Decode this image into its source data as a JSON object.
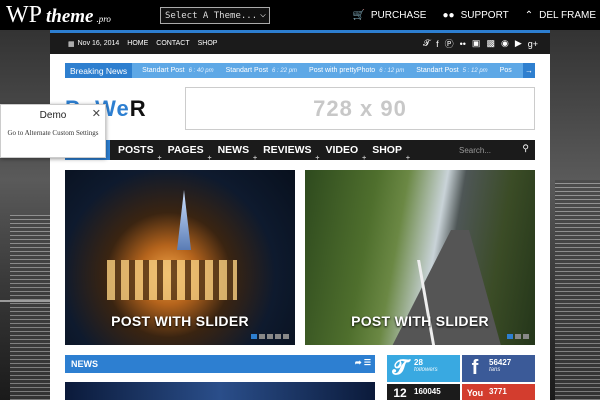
{
  "topbar": {
    "logo_main": "WP",
    "logo_theme": "theme",
    "logo_suffix": ".pro",
    "theme_select": "Select A Theme...",
    "actions": [
      {
        "icon": "cart-icon",
        "label": "PURCHASE"
      },
      {
        "icon": "users-icon",
        "label": "SUPPORT"
      },
      {
        "icon": "chevron-up-icon",
        "label": "DEL FRAME"
      }
    ]
  },
  "header": {
    "date": "Nov 16, 2014",
    "links": [
      "HOME",
      "CONTACT",
      "SHOP"
    ],
    "social": [
      "twitter-icon",
      "facebook-icon",
      "pinterest-icon",
      "flickr-icon",
      "instagram-icon",
      "linkedin-icon",
      "dribbble-icon",
      "youtube-icon",
      "google-plus-icon"
    ]
  },
  "breaking": {
    "label": "Breaking News",
    "items": [
      {
        "title": "Standart Post",
        "time": "6 : 40 pm"
      },
      {
        "title": "Standart Post",
        "time": "6 : 22 pm"
      },
      {
        "title": "Post with prettyPhoto",
        "time": "6 : 12 pm"
      },
      {
        "title": "Standart Post",
        "time": "5 : 12 pm"
      },
      {
        "title": "Pos",
        "time": ""
      }
    ]
  },
  "site": {
    "logo_a": "PoWe",
    "logo_b": "R",
    "ad_text": "728 x 90"
  },
  "nav": {
    "items": [
      "POSTS",
      "PAGES",
      "NEWS",
      "REVIEWS",
      "VIDEO",
      "SHOP"
    ],
    "search_placeholder": "Search..."
  },
  "slides": [
    {
      "caption": "POST WITH SLIDER"
    },
    {
      "caption": "POST WITH SLIDER"
    }
  ],
  "news": {
    "title": "NEWS"
  },
  "counters": {
    "twitter": {
      "count": "28",
      "label": "followers"
    },
    "facebook": {
      "count": "56427",
      "label": "fans"
    },
    "third": {
      "count": "160045",
      "label": ""
    },
    "youtube": {
      "count": "3771",
      "label": ""
    }
  },
  "demo": {
    "title": "Demo",
    "link": "Go to Alternate Custom Settings"
  },
  "colors": {
    "accent": "#2d7fd1",
    "breaking": "#5ea8e6"
  }
}
